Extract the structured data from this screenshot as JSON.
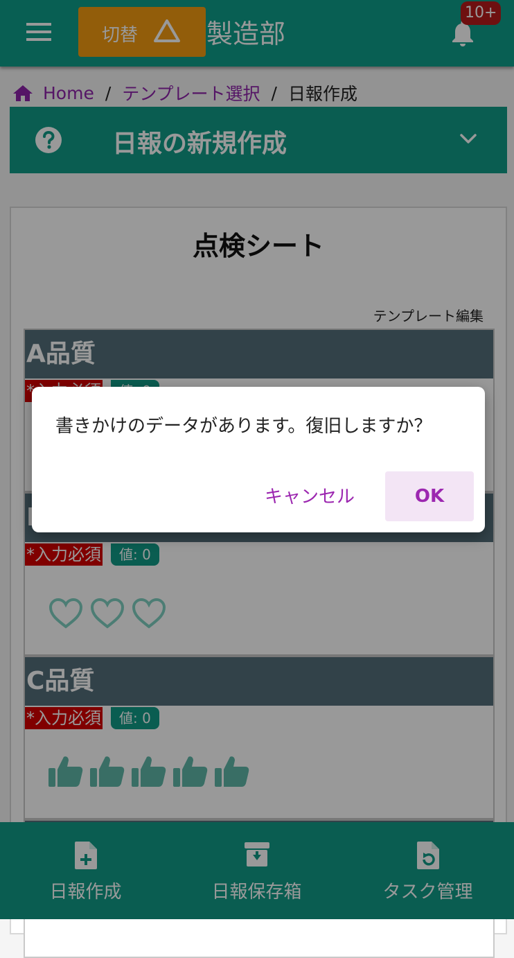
{
  "header": {
    "switch_label": "切替",
    "department": "製造部",
    "notification_badge": "10+"
  },
  "breadcrumb": {
    "home": "Home",
    "separator": "/",
    "template_select": "テンプレート選択",
    "current": "日報作成"
  },
  "section": {
    "title": "日報の新規作成"
  },
  "card": {
    "title": "点検シート",
    "template_edit": "テンプレート編集",
    "items": [
      {
        "title": "A品質",
        "required": "*入力必須",
        "value": "値: 0"
      },
      {
        "title": "B品質",
        "required": "*入力必須",
        "value": "値: 0"
      },
      {
        "title": "C品質",
        "required": "*入力必須",
        "value": "値: 0"
      }
    ]
  },
  "bottom_nav": {
    "create": "日報作成",
    "archive": "日報保存箱",
    "task": "タスク管理"
  },
  "dialog": {
    "message": "書きかけのデータがあります。復旧しますか？",
    "cancel": "キャンセル",
    "ok": "OK"
  },
  "colors": {
    "primary": "#0e9f8a",
    "accent": "#f39c12",
    "item_header": "#546e7a",
    "required": "#d50000",
    "link": "#8e24aa"
  }
}
